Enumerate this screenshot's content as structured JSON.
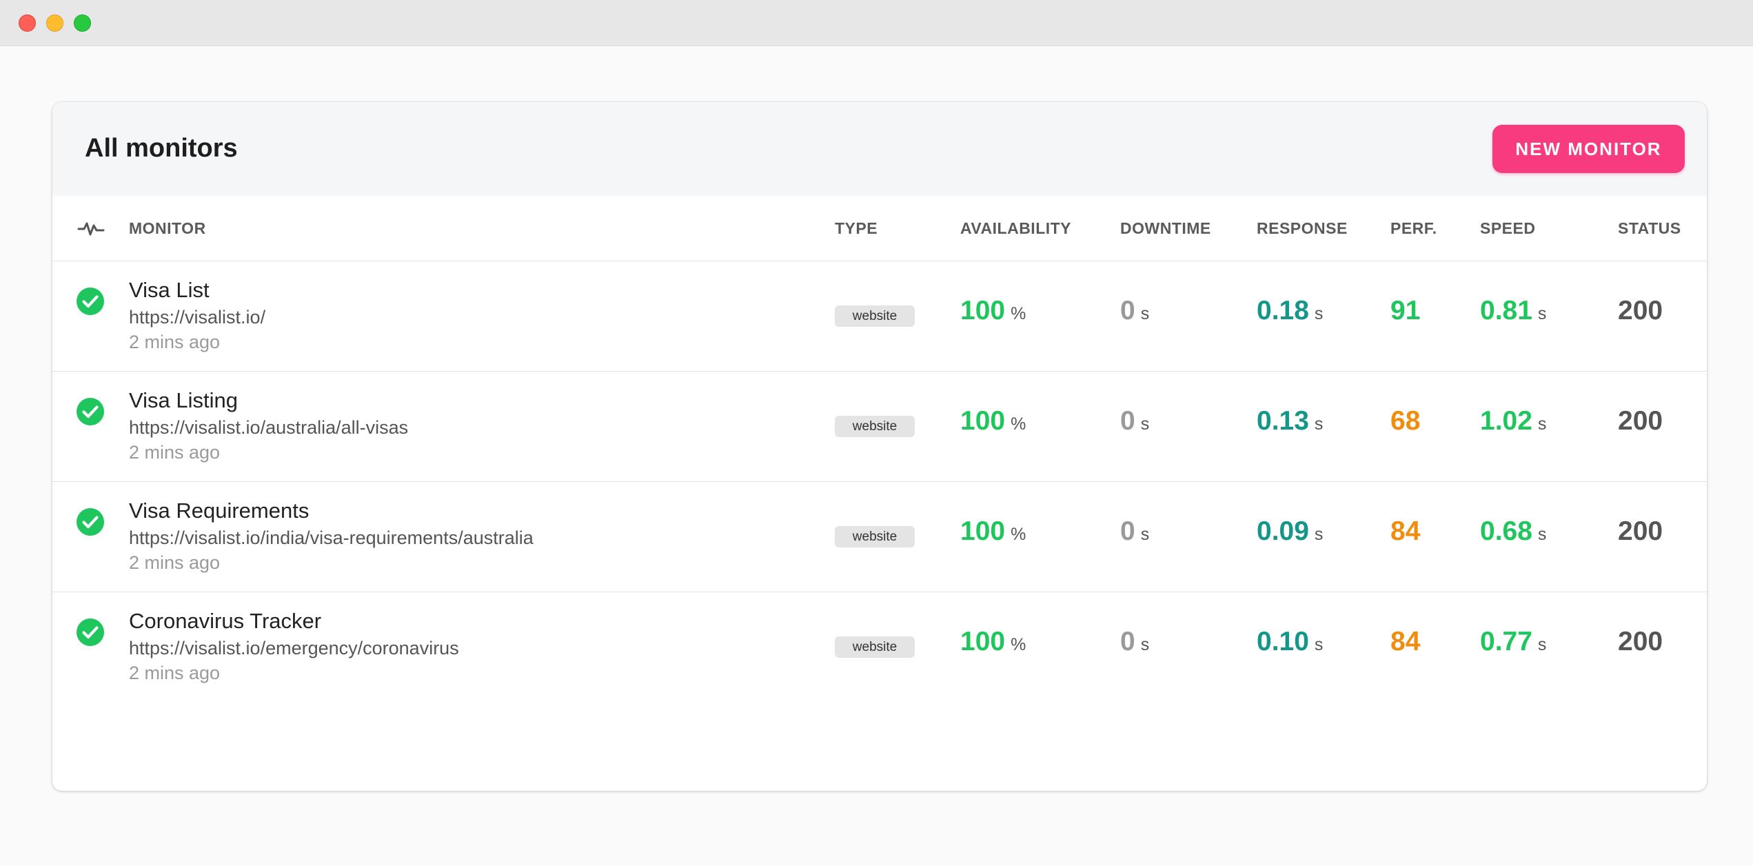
{
  "window": {
    "controls": [
      "close",
      "minimize",
      "maximize"
    ]
  },
  "header": {
    "title": "All monitors",
    "new_button_label": "NEW MONITOR"
  },
  "columns": {
    "monitor": "MONITOR",
    "type": "TYPE",
    "availability": "AVAILABILITY",
    "downtime": "DOWNTIME",
    "response": "RESPONSE",
    "perf": "PERF.",
    "speed": "SPEED",
    "status": "STATUS"
  },
  "rows": [
    {
      "name": "Visa List",
      "url": "https://visalist.io/",
      "checked": "2 mins ago",
      "type": "website",
      "availability": "100",
      "availability_unit": "%",
      "downtime": "0",
      "downtime_unit": "s",
      "response": "0.18",
      "response_unit": "s",
      "perf": "91",
      "speed": "0.81",
      "speed_unit": "s",
      "status": "200"
    },
    {
      "name": "Visa Listing",
      "url": "https://visalist.io/australia/all-visas",
      "checked": "2 mins ago",
      "type": "website",
      "availability": "100",
      "availability_unit": "%",
      "downtime": "0",
      "downtime_unit": "s",
      "response": "0.13",
      "response_unit": "s",
      "perf": "68",
      "speed": "1.02",
      "speed_unit": "s",
      "status": "200"
    },
    {
      "name": "Visa Requirements",
      "url": "https://visalist.io/india/visa-requirements/australia",
      "checked": "2 mins ago",
      "type": "website",
      "availability": "100",
      "availability_unit": "%",
      "downtime": "0",
      "downtime_unit": "s",
      "response": "0.09",
      "response_unit": "s",
      "perf": "84",
      "speed": "0.68",
      "speed_unit": "s",
      "status": "200"
    },
    {
      "name": "Coronavirus Tracker",
      "url": "https://visalist.io/emergency/coronavirus",
      "checked": "2 mins ago",
      "type": "website",
      "availability": "100",
      "availability_unit": "%",
      "downtime": "0",
      "downtime_unit": "s",
      "response": "0.10",
      "response_unit": "s",
      "perf": "84",
      "speed": "0.77",
      "speed_unit": "s",
      "status": "200"
    }
  ],
  "colors": {
    "accent": "#f73b7e",
    "ok_green": "#1fc55d",
    "response_teal": "#14968a",
    "warning_orange": "#f08d0c"
  }
}
